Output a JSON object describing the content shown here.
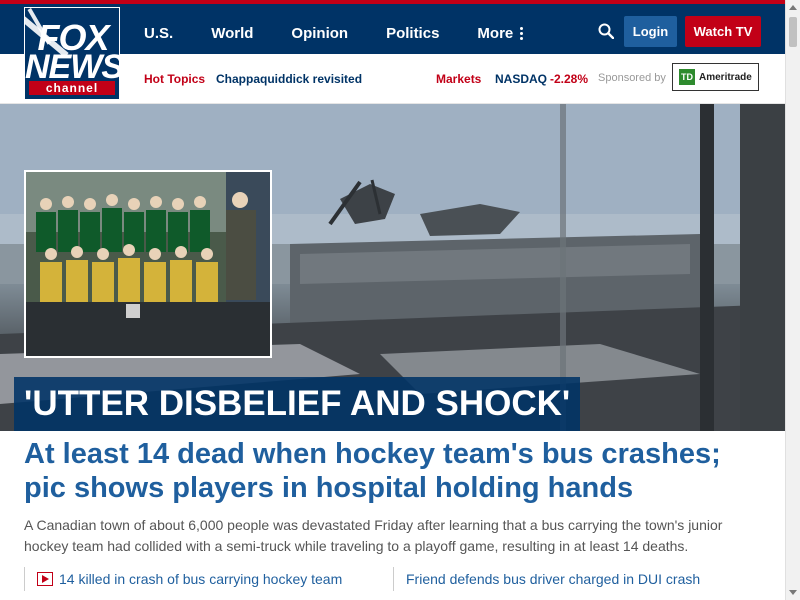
{
  "brand": {
    "logo_top": "FOX",
    "logo_bottom": "NEWS",
    "logo_channel": "channel",
    "colors": {
      "navy": "#003366",
      "red": "#c20017",
      "link_blue": "#1f5f9e"
    }
  },
  "nav": {
    "items": [
      "U.S.",
      "World",
      "Opinion",
      "Politics"
    ],
    "more_label": "More",
    "search_icon": "search-icon",
    "login_label": "Login",
    "watch_label": "Watch TV"
  },
  "subbar": {
    "hot_topics_label": "Hot Topics",
    "trending_link": "Chappaquiddick revisited",
    "markets_label": "Markets",
    "ticker_name": "NASDAQ",
    "ticker_change": "-2.28%",
    "sponsored_label": "Sponsored by",
    "sponsor_logo_text": "Ameritrade",
    "sponsor_logo_mark": "TD"
  },
  "hero": {
    "overlay_title": "'UTTER DISBELIEF AND SHOCK'"
  },
  "article": {
    "headline": "At least 14 dead when hockey team's bus crashes; pic shows players in hospital holding hands",
    "dek": "A Canadian town of about 6,000 people was devastated Friday after learning that a bus carrying the town's junior hockey team had collided with a semi-truck while traveling to a playoff game, resulting in at least 14 deaths.",
    "related": [
      {
        "text": "14 killed in crash of bus carrying hockey team",
        "icon": "video-play-icon"
      },
      {
        "text": "Friend defends bus driver charged in DUI crash"
      }
    ]
  }
}
